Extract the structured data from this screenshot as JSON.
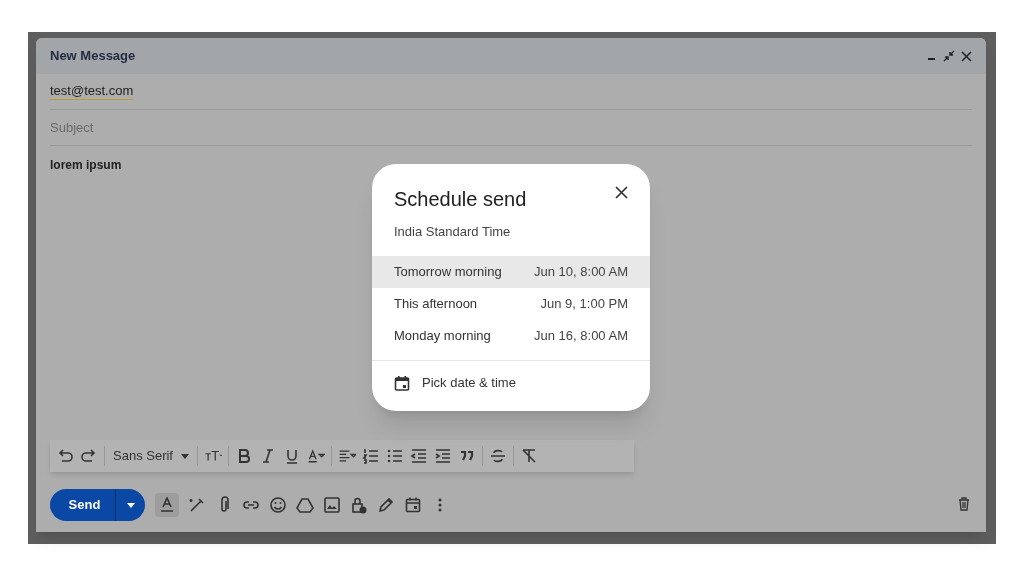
{
  "compose": {
    "title": "New Message",
    "to": "test@test.com",
    "subject": {
      "placeholder": "Subject"
    },
    "body": "lorem ipsum"
  },
  "format_toolbar": {
    "font": "Sans Serif"
  },
  "send_button": {
    "label": "Send"
  },
  "schedule_dialog": {
    "title": "Schedule send",
    "timezone": "India Standard Time",
    "options": [
      {
        "label": "Tomorrow morning",
        "time": "Jun 10, 8:00 AM",
        "selected": true
      },
      {
        "label": "This afternoon",
        "time": "Jun 9, 1:00 PM",
        "selected": false
      },
      {
        "label": "Monday morning",
        "time": "Jun 16, 8:00 AM",
        "selected": false
      }
    ],
    "pick_label": "Pick date & time"
  }
}
